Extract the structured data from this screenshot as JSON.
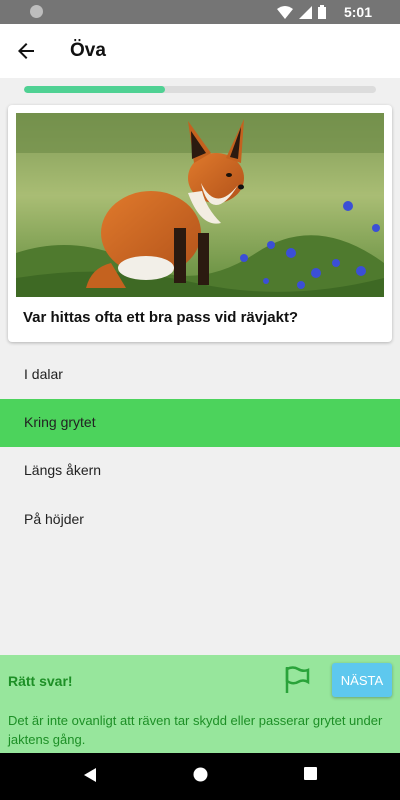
{
  "status_bar": {
    "time": "5:01"
  },
  "app_bar": {
    "title": "Öva"
  },
  "progress": {
    "fraction": 0.4
  },
  "question": {
    "image_subject": "red fox sitting in grass",
    "text": "Var hittas ofta ett bra pass vid rävjakt?"
  },
  "options": [
    {
      "label": "I dalar",
      "state": "default"
    },
    {
      "label": "Kring grytet",
      "state": "correct"
    },
    {
      "label": "Längs åkern",
      "state": "default"
    },
    {
      "label": "På höjder",
      "state": "default"
    }
  ],
  "feedback": {
    "label": "Rätt svar!",
    "next_button": "NÄSTA",
    "explanation": "Det är inte ovanligt att räven tar skydd eller passerar grytet under jaktens gång."
  },
  "colors": {
    "progress_fill": "#4fd193",
    "correct_option": "#4cd35c",
    "feedback_bg": "#97e69c",
    "feedback_text": "#1d8f26",
    "next_button": "#5ec8ee"
  }
}
